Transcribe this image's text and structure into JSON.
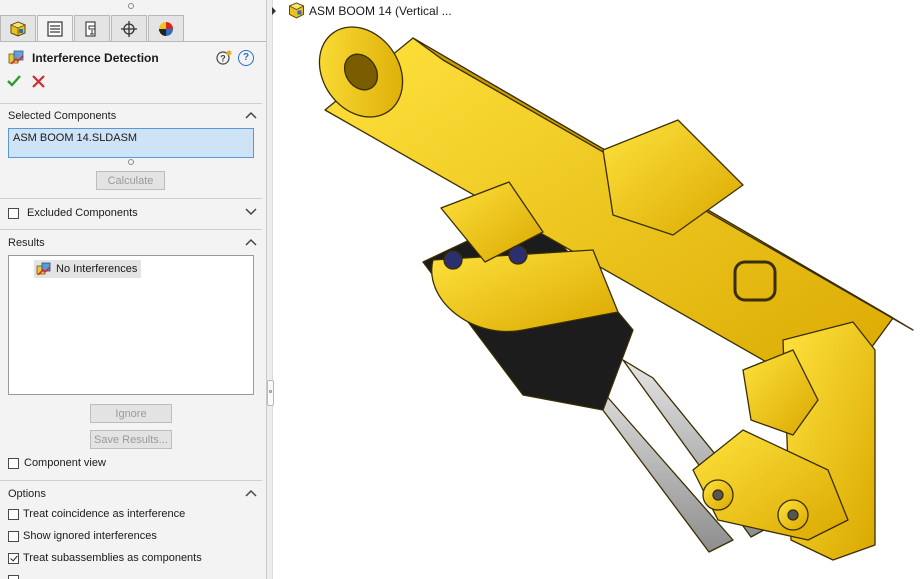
{
  "property_manager": {
    "title": "Interference Detection",
    "tabs": [
      {
        "icon": "feature-manager-icon"
      },
      {
        "icon": "property-manager-icon"
      },
      {
        "icon": "configuration-manager-icon"
      },
      {
        "icon": "dimxpert-manager-icon"
      },
      {
        "icon": "display-manager-icon"
      }
    ]
  },
  "selected_components": {
    "heading": "Selected Components",
    "value": "ASM BOOM 14.SLDASM",
    "calculate_label": "Calculate"
  },
  "excluded_components": {
    "heading": "Excluded Components",
    "checked": false
  },
  "results": {
    "heading": "Results",
    "items": [
      {
        "label": "No Interferences"
      }
    ],
    "ignore_label": "Ignore",
    "save_label": "Save Results...",
    "component_view_label": "Component view"
  },
  "options": {
    "heading": "Options",
    "items": [
      {
        "label": "Treat coincidence as interference",
        "checked": false
      },
      {
        "label": "Show ignored interferences",
        "checked": false
      },
      {
        "label": "Treat subassemblies as components",
        "checked": true
      }
    ]
  },
  "tree": {
    "root_label": "ASM BOOM 14  (Vertical ..."
  },
  "colors": {
    "part_yellow": "#f2c500",
    "cylinder_black": "#1c1c1c",
    "rod_gray": "#b9b9b9",
    "accent_blue": "#2a6fbf",
    "ok_green": "#2e9a2e",
    "cancel_red": "#d12b2b"
  }
}
